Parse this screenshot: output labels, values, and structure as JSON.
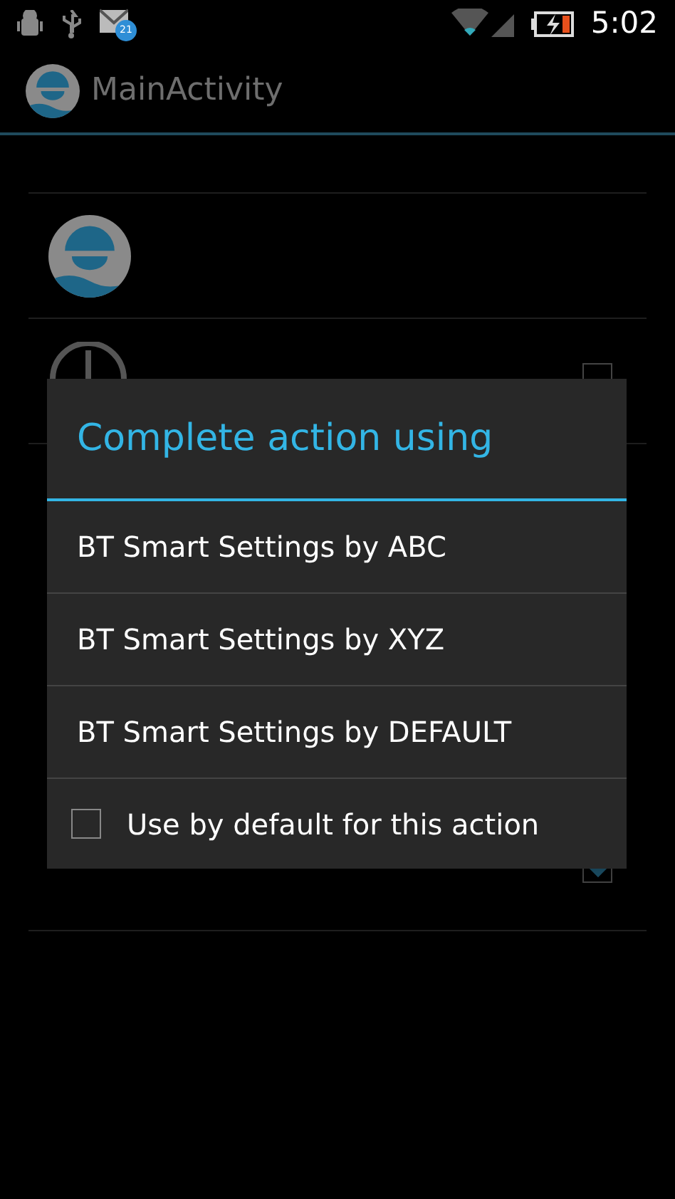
{
  "status_bar": {
    "badge": "21",
    "time": "5:02"
  },
  "action_bar": {
    "title": "MainActivity"
  },
  "list": [
    {
      "kind": "avatar"
    },
    {
      "kind": "clock_toggle",
      "checked": false
    },
    {
      "kind": "toggle",
      "checked": true
    }
  ],
  "dialog": {
    "title": "Complete action using",
    "options": [
      "BT Smart Settings by ABC",
      "BT Smart Settings by XYZ",
      "BT Smart Settings by DEFAULT"
    ],
    "remember": {
      "label": "Use by default for this action",
      "checked": false
    }
  }
}
